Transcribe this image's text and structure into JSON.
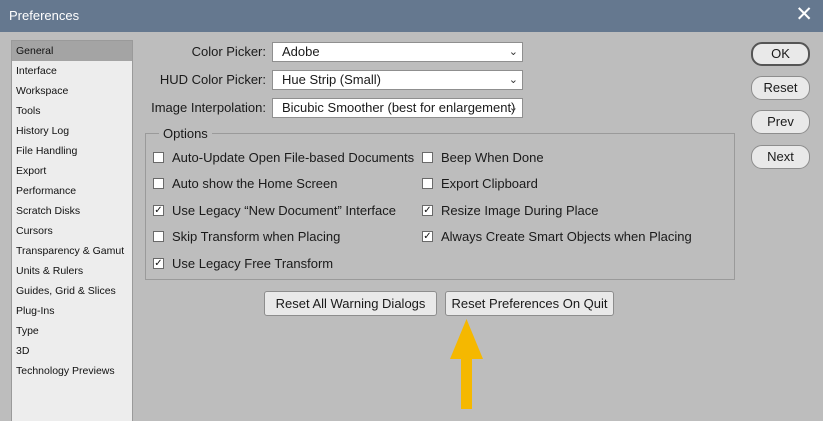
{
  "window": {
    "title": "Preferences"
  },
  "sidebar": {
    "items": [
      {
        "label": "General",
        "active": true
      },
      {
        "label": "Interface"
      },
      {
        "label": "Workspace"
      },
      {
        "label": "Tools"
      },
      {
        "label": "History Log"
      },
      {
        "label": "File Handling"
      },
      {
        "label": "Export"
      },
      {
        "label": "Performance"
      },
      {
        "label": "Scratch Disks"
      },
      {
        "label": "Cursors"
      },
      {
        "label": "Transparency & Gamut"
      },
      {
        "label": "Units & Rulers"
      },
      {
        "label": "Guides, Grid & Slices"
      },
      {
        "label": "Plug-Ins"
      },
      {
        "label": "Type"
      },
      {
        "label": "3D"
      },
      {
        "label": "Technology Previews"
      }
    ]
  },
  "fields": {
    "color_picker": {
      "label": "Color Picker:",
      "value": "Adobe"
    },
    "hud_color_picker": {
      "label": "HUD Color Picker:",
      "value": "Hue Strip (Small)"
    },
    "image_interpolation": {
      "label": "Image Interpolation:",
      "value": "Bicubic Smoother (best for enlargement)"
    }
  },
  "options": {
    "legend": "Options",
    "left": [
      {
        "label": "Auto-Update Open File-based Documents",
        "checked": false
      },
      {
        "label": "Auto show the Home Screen",
        "checked": false
      },
      {
        "label": "Use Legacy “New Document” Interface",
        "checked": true
      },
      {
        "label": "Skip Transform when Placing",
        "checked": false
      },
      {
        "label": "Use Legacy Free Transform",
        "checked": true
      }
    ],
    "right": [
      {
        "label": "Beep When Done",
        "checked": false
      },
      {
        "label": "Export Clipboard",
        "checked": false
      },
      {
        "label": "Resize Image During Place",
        "checked": true
      },
      {
        "label": "Always Create Smart Objects when Placing",
        "checked": true
      }
    ]
  },
  "buttons": {
    "reset_warnings": "Reset All Warning Dialogs",
    "reset_prefs": "Reset Preferences On Quit",
    "ok": "OK",
    "reset": "Reset",
    "prev": "Prev",
    "next": "Next"
  },
  "icons": {
    "close": "close-icon",
    "dropdown": "chevron-down-icon",
    "annotation": "arrow-up-icon"
  },
  "colors": {
    "titlebar": "#65788f",
    "dialog_bg": "#bdbdbd",
    "arrow": "#f5b800"
  }
}
